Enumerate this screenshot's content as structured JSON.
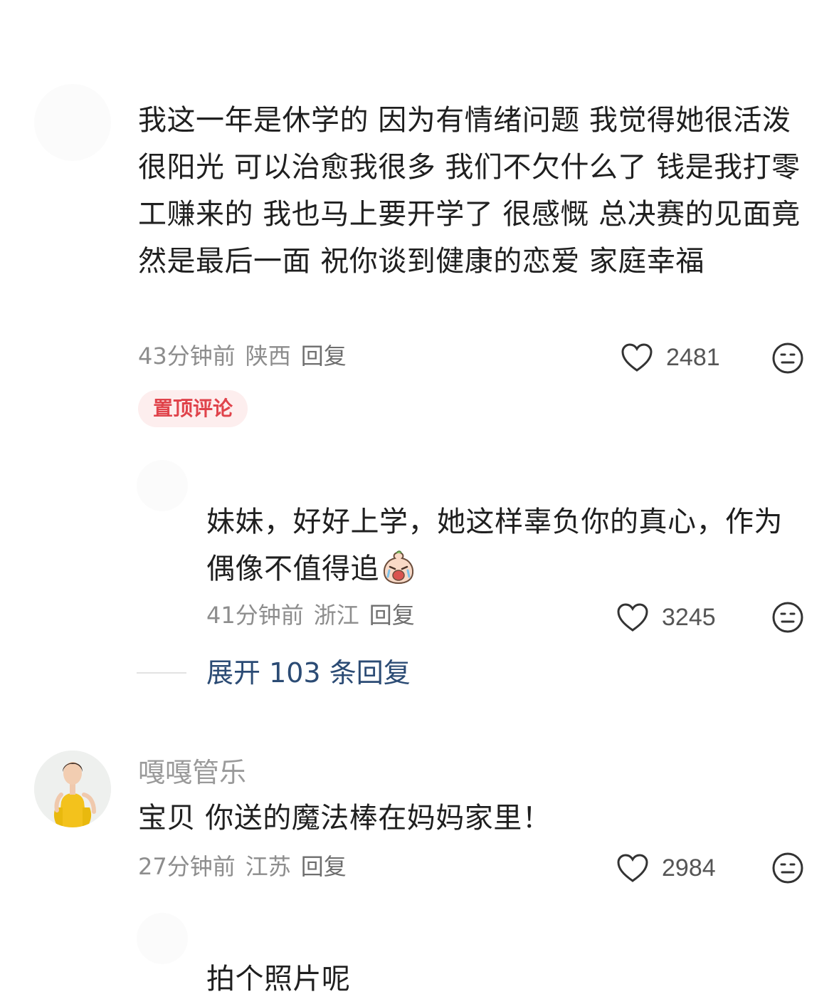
{
  "comments": [
    {
      "text": "我这一年是休学的 因为有情绪问题 我觉得她很活泼很阳光 可以治愈我很多 我们不欠什么了 钱是我打零工赚来的 我也马上要开学了 很感慨 总决赛的见面竟然是最后一面 祝你谈到健康的恋爱 家庭幸福",
      "time": "43分钟前",
      "location": "陕西",
      "reply_label": "回复",
      "likes": "2481",
      "badge": "置顶评论"
    },
    {
      "text": "妹妹，好好上学，她这样辜负你的真心，作为偶像不值得追",
      "emoji": "crying-face-emoji",
      "time": "41分钟前",
      "location": "浙江",
      "reply_label": "回复",
      "likes": "3245",
      "expand_label": "展开 103 条回复"
    },
    {
      "username": "嘎嘎管乐",
      "text": "宝贝 你送的魔法棒在妈妈家里！",
      "time": "27分钟前",
      "location": "江苏",
      "reply_label": "回复",
      "likes": "2984"
    },
    {
      "text": "拍个照片呢"
    }
  ],
  "colors": {
    "badge_text": "#e0434b",
    "badge_bg": "#fdeeee",
    "expand_text": "#2b4b74",
    "meta_text": "#8d8d8d"
  },
  "icons": {
    "like": "heart-outline-icon",
    "dislike": "neutral-face-icon"
  }
}
